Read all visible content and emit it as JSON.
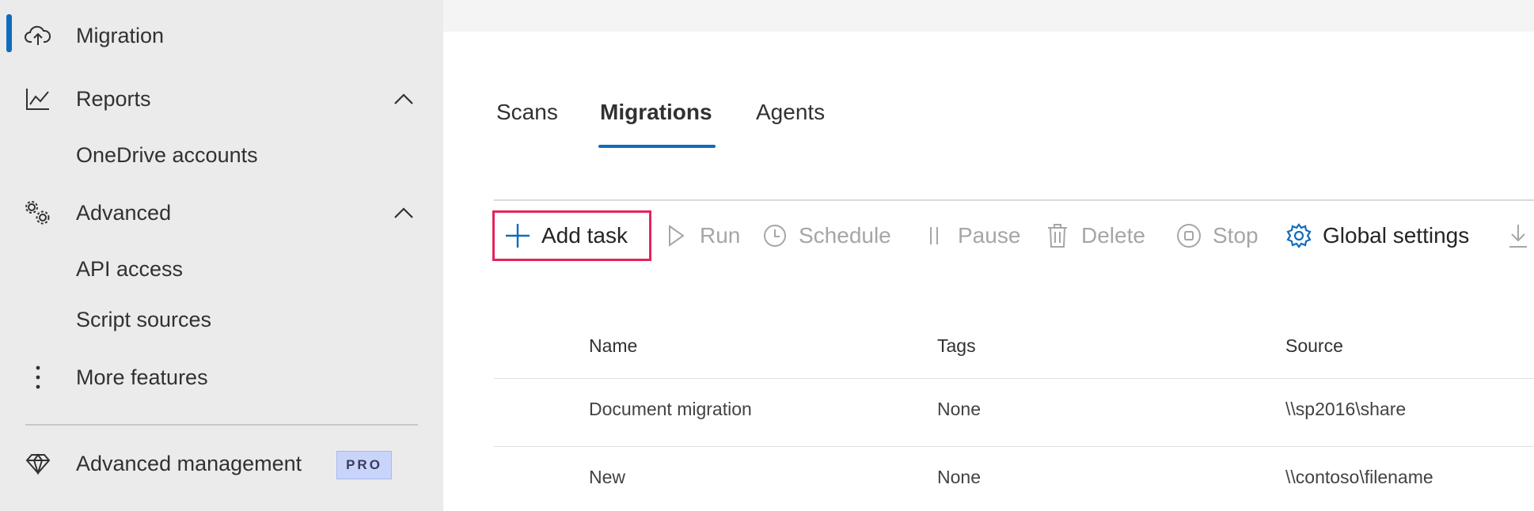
{
  "sidebar": {
    "items": [
      {
        "label": "Migration",
        "icon": "cloud-upload-icon",
        "active": true
      },
      {
        "label": "Reports",
        "icon": "line-chart-icon",
        "expanded": true
      },
      {
        "label": "OneDrive accounts"
      },
      {
        "label": "Advanced",
        "icon": "gears-icon",
        "expanded": true
      },
      {
        "label": "API access"
      },
      {
        "label": "Script sources"
      },
      {
        "label": "More features",
        "icon": "more-vertical-icon"
      },
      {
        "label": "Advanced management",
        "icon": "diamond-icon",
        "badge": "PRO"
      }
    ]
  },
  "tabs": [
    {
      "label": "Scans"
    },
    {
      "label": "Migrations",
      "active": true
    },
    {
      "label": "Agents"
    }
  ],
  "toolbar": {
    "add_task": "Add task",
    "run": "Run",
    "schedule": "Schedule",
    "pause": "Pause",
    "delete": "Delete",
    "stop": "Stop",
    "global_settings": "Global settings"
  },
  "table": {
    "columns": [
      "Name",
      "Tags",
      "Source"
    ],
    "rows": [
      {
        "name": "Document migration",
        "tags": "None",
        "source": "\\\\sp2016\\share"
      },
      {
        "name": "New",
        "tags": "None",
        "source": "\\\\contoso\\filename"
      }
    ]
  },
  "colors": {
    "accent": "#0f6cbd",
    "highlight": "#e3245b",
    "sidebar_bg": "#ebebeb"
  }
}
